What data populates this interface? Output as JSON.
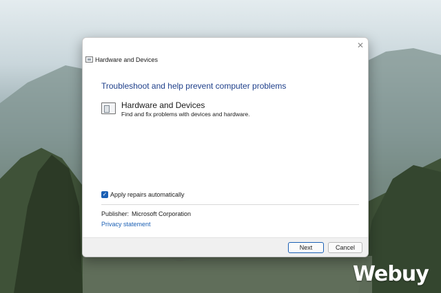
{
  "dialog": {
    "title": "Hardware and Devices",
    "close_glyph": "✕",
    "heading": "Troubleshoot and help prevent computer problems",
    "item": {
      "title": "Hardware and Devices",
      "description": "Find and fix problems with devices and hardware.",
      "icon": "hardware-troubleshooter-icon"
    },
    "apply_repairs": {
      "label": "Apply repairs automatically",
      "checked": true
    },
    "publisher_label": "Publisher:",
    "publisher_value": "Microsoft Corporation",
    "privacy_link": "Privacy statement",
    "buttons": {
      "next": "Next",
      "cancel": "Cancel"
    }
  },
  "watermark": "Webuy",
  "colors": {
    "accent": "#1a5fb4",
    "heading": "#1e3f8a",
    "footer_bg": "#f0f0f0"
  }
}
